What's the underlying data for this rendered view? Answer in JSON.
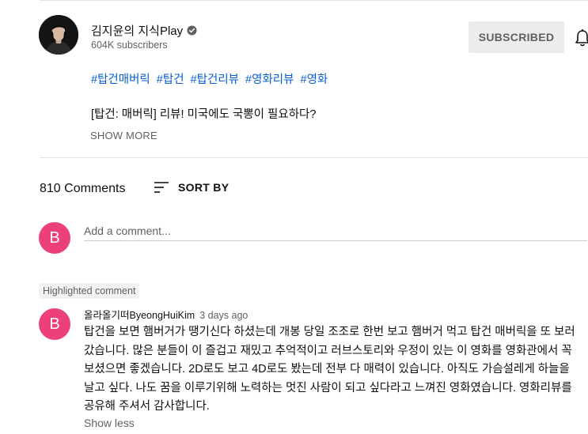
{
  "channel": {
    "name": "김지윤의 지식Play",
    "subscribers": "604K subscribers",
    "subscribe_label": "SUBSCRIBED"
  },
  "description": {
    "hashtags": [
      "#탑건매버릭",
      "#탑건",
      "#탑건리뷰",
      "#영화리뷰",
      "#영화"
    ],
    "title": "[탑건: 매버릭] 리뷰! 미국에도 국뽕이 필요하다?",
    "show_more_label": "SHOW MORE"
  },
  "comments": {
    "count_label": "810 Comments",
    "sort_label": "SORT BY",
    "add_placeholder": "Add a comment...",
    "user_initial": "B",
    "highlighted": {
      "badge": "Highlighted comment",
      "author": "올라올기떠ByeongHuiKim",
      "time": "3 days ago",
      "initial": "B",
      "text": "탑건을 보면 햄버거가 땡기신다 하셨는데 개봉 당일 조조로 한번 보고 햄버거 먹고 탑건 매버릭을 또 보러 갔습니다. 많은 분들이 이 즐겁고 재밌고 추억적이고 러브스토리와 우정이 있는 이 영화를 영화관에서 꼭 보셨으면 좋겠습니다. 2D로도 보고 4D로도 봤는데 전부 다 매력이 있습니다. 아직도 가슴설레게 하늘을 날고 싶다. 나도 꿈을 이루기위해 노력하는 멋진 사람이 되고 싶다라고 느껴진 영화였습니다. 영화리뷰를 공유해 주셔서 감사합니다.",
      "show_less_label": "Show less"
    }
  },
  "colors": {
    "link": "#065fd4",
    "avatar_pink": "#ec407a",
    "subscribed_bg": "#ececec"
  }
}
